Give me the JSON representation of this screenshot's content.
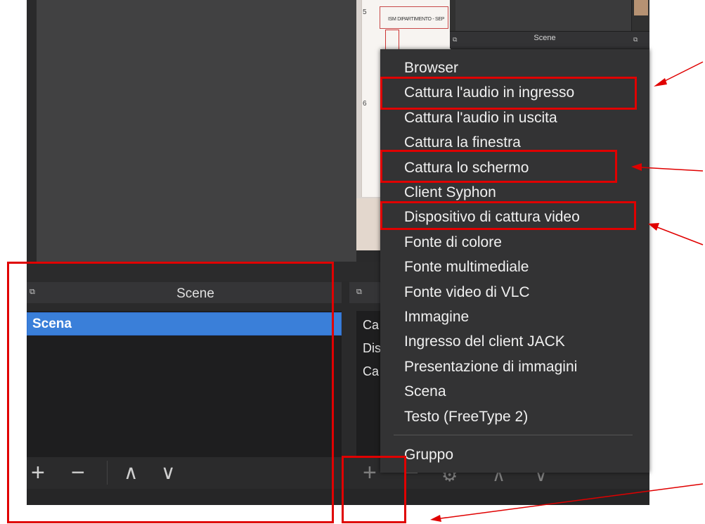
{
  "preview": {
    "thumb_numbers": [
      "5",
      "6"
    ],
    "thumb_text": "ISM DIPARTIMENTO - SEP"
  },
  "mini_panel": {
    "title": "Scene"
  },
  "scenes_panel": {
    "title": "Scene",
    "items": [
      "Scena"
    ],
    "toolbar": {
      "add": "+",
      "remove": "−",
      "up": "∧",
      "down": "∨"
    }
  },
  "sources_panel": {
    "items": [
      "Ca",
      "Dis",
      "Ca"
    ],
    "toolbar": {
      "add": "+",
      "remove": "−",
      "settings": "⚙",
      "up": "∧",
      "down": "∨"
    }
  },
  "context_menu": {
    "items": [
      "Browser",
      "Cattura l'audio in ingresso",
      "Cattura l'audio in uscita",
      "Cattura la finestra",
      "Cattura lo schermo",
      "Client Syphon",
      "Dispositivo di cattura video",
      "Fonte di colore",
      "Fonte multimediale",
      "Fonte video di VLC",
      "Immagine",
      "Ingresso del client JACK",
      "Presentazione di immagini",
      "Scena",
      "Testo (FreeType 2)"
    ],
    "group_item": "Gruppo"
  },
  "icons": {
    "dock": "dock-float-icon",
    "add": "plus-icon",
    "remove": "minus-icon",
    "up": "chevron-up-icon",
    "down": "chevron-down-icon",
    "settings": "gear-icon"
  },
  "colors": {
    "highlight": "#e00000",
    "selection": "#3a7fd9"
  }
}
